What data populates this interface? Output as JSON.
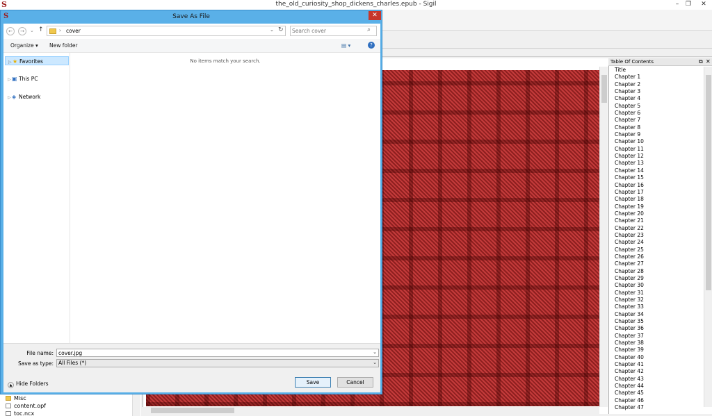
{
  "main_window": {
    "title": "the_old_curiosity_shop_dickens_charles.epub - Sigil",
    "logo": "S",
    "minimize": "–",
    "restore": "❐",
    "close": "✕"
  },
  "book_browser": {
    "items": [
      {
        "label": "Misc",
        "icon": "folder-icon"
      },
      {
        "label": "content.opf",
        "icon": "file-icon"
      },
      {
        "label": "toc.ncx",
        "icon": "file-icon"
      }
    ]
  },
  "toc": {
    "title": "Table Of Contents",
    "float_btn": "⧉",
    "close_btn": "✕",
    "entries": [
      "Title",
      "Chapter 1",
      "Chapter 2",
      "Chapter 3",
      "Chapter 4",
      "Chapter 5",
      "Chapter 6",
      "Chapter 7",
      "Chapter 8",
      "Chapter 9",
      "Chapter 10",
      "Chapter 11",
      "Chapter 12",
      "Chapter 13",
      "Chapter 14",
      "Chapter 15",
      "Chapter 16",
      "Chapter 17",
      "Chapter 18",
      "Chapter 19",
      "Chapter 20",
      "Chapter 21",
      "Chapter 22",
      "Chapter 23",
      "Chapter 24",
      "Chapter 25",
      "Chapter 26",
      "Chapter 27",
      "Chapter 28",
      "Chapter 29",
      "Chapter 30",
      "Chapter 31",
      "Chapter 32",
      "Chapter 33",
      "Chapter 34",
      "Chapter 35",
      "Chapter 36",
      "Chapter 37",
      "Chapter 38",
      "Chapter 39",
      "Chapter 40",
      "Chapter 41",
      "Chapter 42",
      "Chapter 43",
      "Chapter 44",
      "Chapter 45",
      "Chapter 46",
      "Chapter 47"
    ]
  },
  "dialog": {
    "title": "Save As File",
    "logo": "S",
    "close": "✕",
    "address": {
      "back": "←",
      "forward": "→",
      "history": "⌄",
      "up": "↑",
      "separator": "›",
      "path": "cover",
      "dropdown": "⌄",
      "refresh": "↻"
    },
    "search": {
      "placeholder": "Search cover",
      "icon": "⌕"
    },
    "commands": {
      "organize": "Organize ▾",
      "new_folder": "New folder",
      "view": "▤ ▾",
      "help": "?"
    },
    "nav": {
      "favorites": "Favorites",
      "this_pc": "This PC",
      "network": "Network"
    },
    "empty_message": "No items match your search.",
    "file_name_label": "File name:",
    "file_name_value": "cover.jpg",
    "save_type_label": "Save as type:",
    "save_type_value": "All Files (*)",
    "dropdown": "⌄",
    "hide_folders": "Hide Folders",
    "save_button": "Save",
    "cancel_button": "Cancel"
  },
  "colors": {
    "dialog_frame": "#5ab0e8",
    "close_red": "#c7362b",
    "cover_red": "#a82a2a",
    "selection": "#cce8ff"
  }
}
